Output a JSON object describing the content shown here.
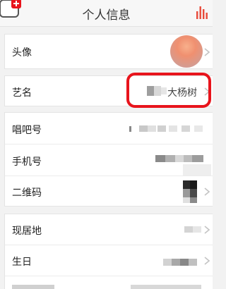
{
  "header": {
    "title": "个人信息"
  },
  "profile": {
    "avatar_label": "头像",
    "stage_name_label": "艺名",
    "stage_name_value": "大杨树",
    "changba_id_label": "唱吧号",
    "phone_label": "手机号",
    "qrcode_label": "二维码",
    "location_label": "现居地",
    "birthday_label": "生日"
  },
  "colors": {
    "accent_red": "#e8141c",
    "chart_icon": "#e84a3a"
  },
  "icons": {
    "back": "back-arrow-icon",
    "chart": "bar-chart-icon",
    "chevron": "chevron-right-icon"
  }
}
